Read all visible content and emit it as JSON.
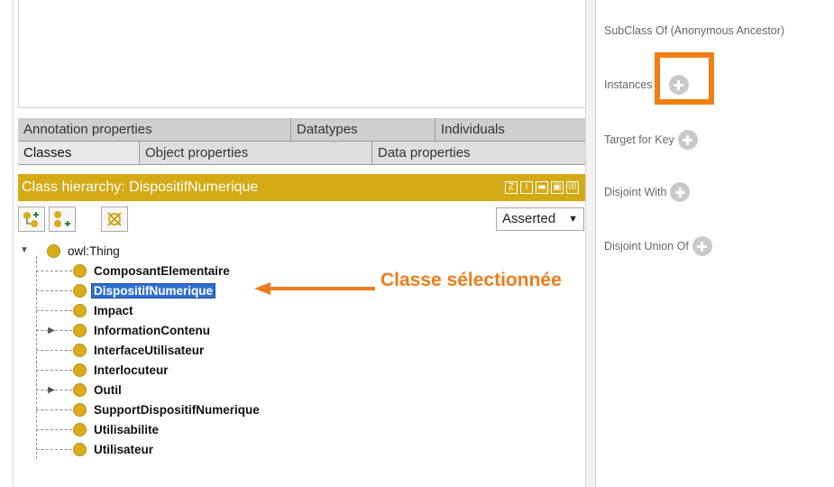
{
  "tabs": {
    "row1": [
      "Annotation properties",
      "Datatypes",
      "Individuals"
    ],
    "row2": [
      "Classes",
      "Object properties",
      "Data properties"
    ]
  },
  "hierarchy": {
    "title": "Class hierarchy: DispositifNumerique",
    "controls": [
      "Z",
      "I",
      "▬",
      "▣",
      "☒"
    ]
  },
  "toolbar": {
    "add_subclass_icon": "add-subclass-icon",
    "add_sibling_icon": "add-sibling-icon",
    "delete_icon": "delete-class-icon",
    "view_mode": "Asserted"
  },
  "tree": {
    "root": "owl:Thing",
    "children": [
      "ComposantElementaire",
      "DispositifNumerique",
      "Impact",
      "InformationContenu",
      "InterfaceUtilisateur",
      "Interlocuteur",
      "Outil",
      "SupportDispositifNumerique",
      "Utilisabilite",
      "Utilisateur"
    ],
    "selected": "DispositifNumerique",
    "expandable": [
      "InformationContenu",
      "Outil"
    ]
  },
  "annotation": {
    "label": "Classe sélectionnée",
    "color": "#ef7b1a"
  },
  "right_panel": {
    "subclass_of_anonymous": "SubClass Of (Anonymous Ancestor)",
    "instances": "Instances",
    "target_for_key": "Target for Key",
    "disjoint_with": "Disjoint With",
    "disjoint_union_of": "Disjoint Union Of"
  },
  "colors": {
    "header": "#d4aa14",
    "class_node": "#d9ad1a",
    "selection": "#2f6fd1",
    "highlight": "#f07e12"
  }
}
